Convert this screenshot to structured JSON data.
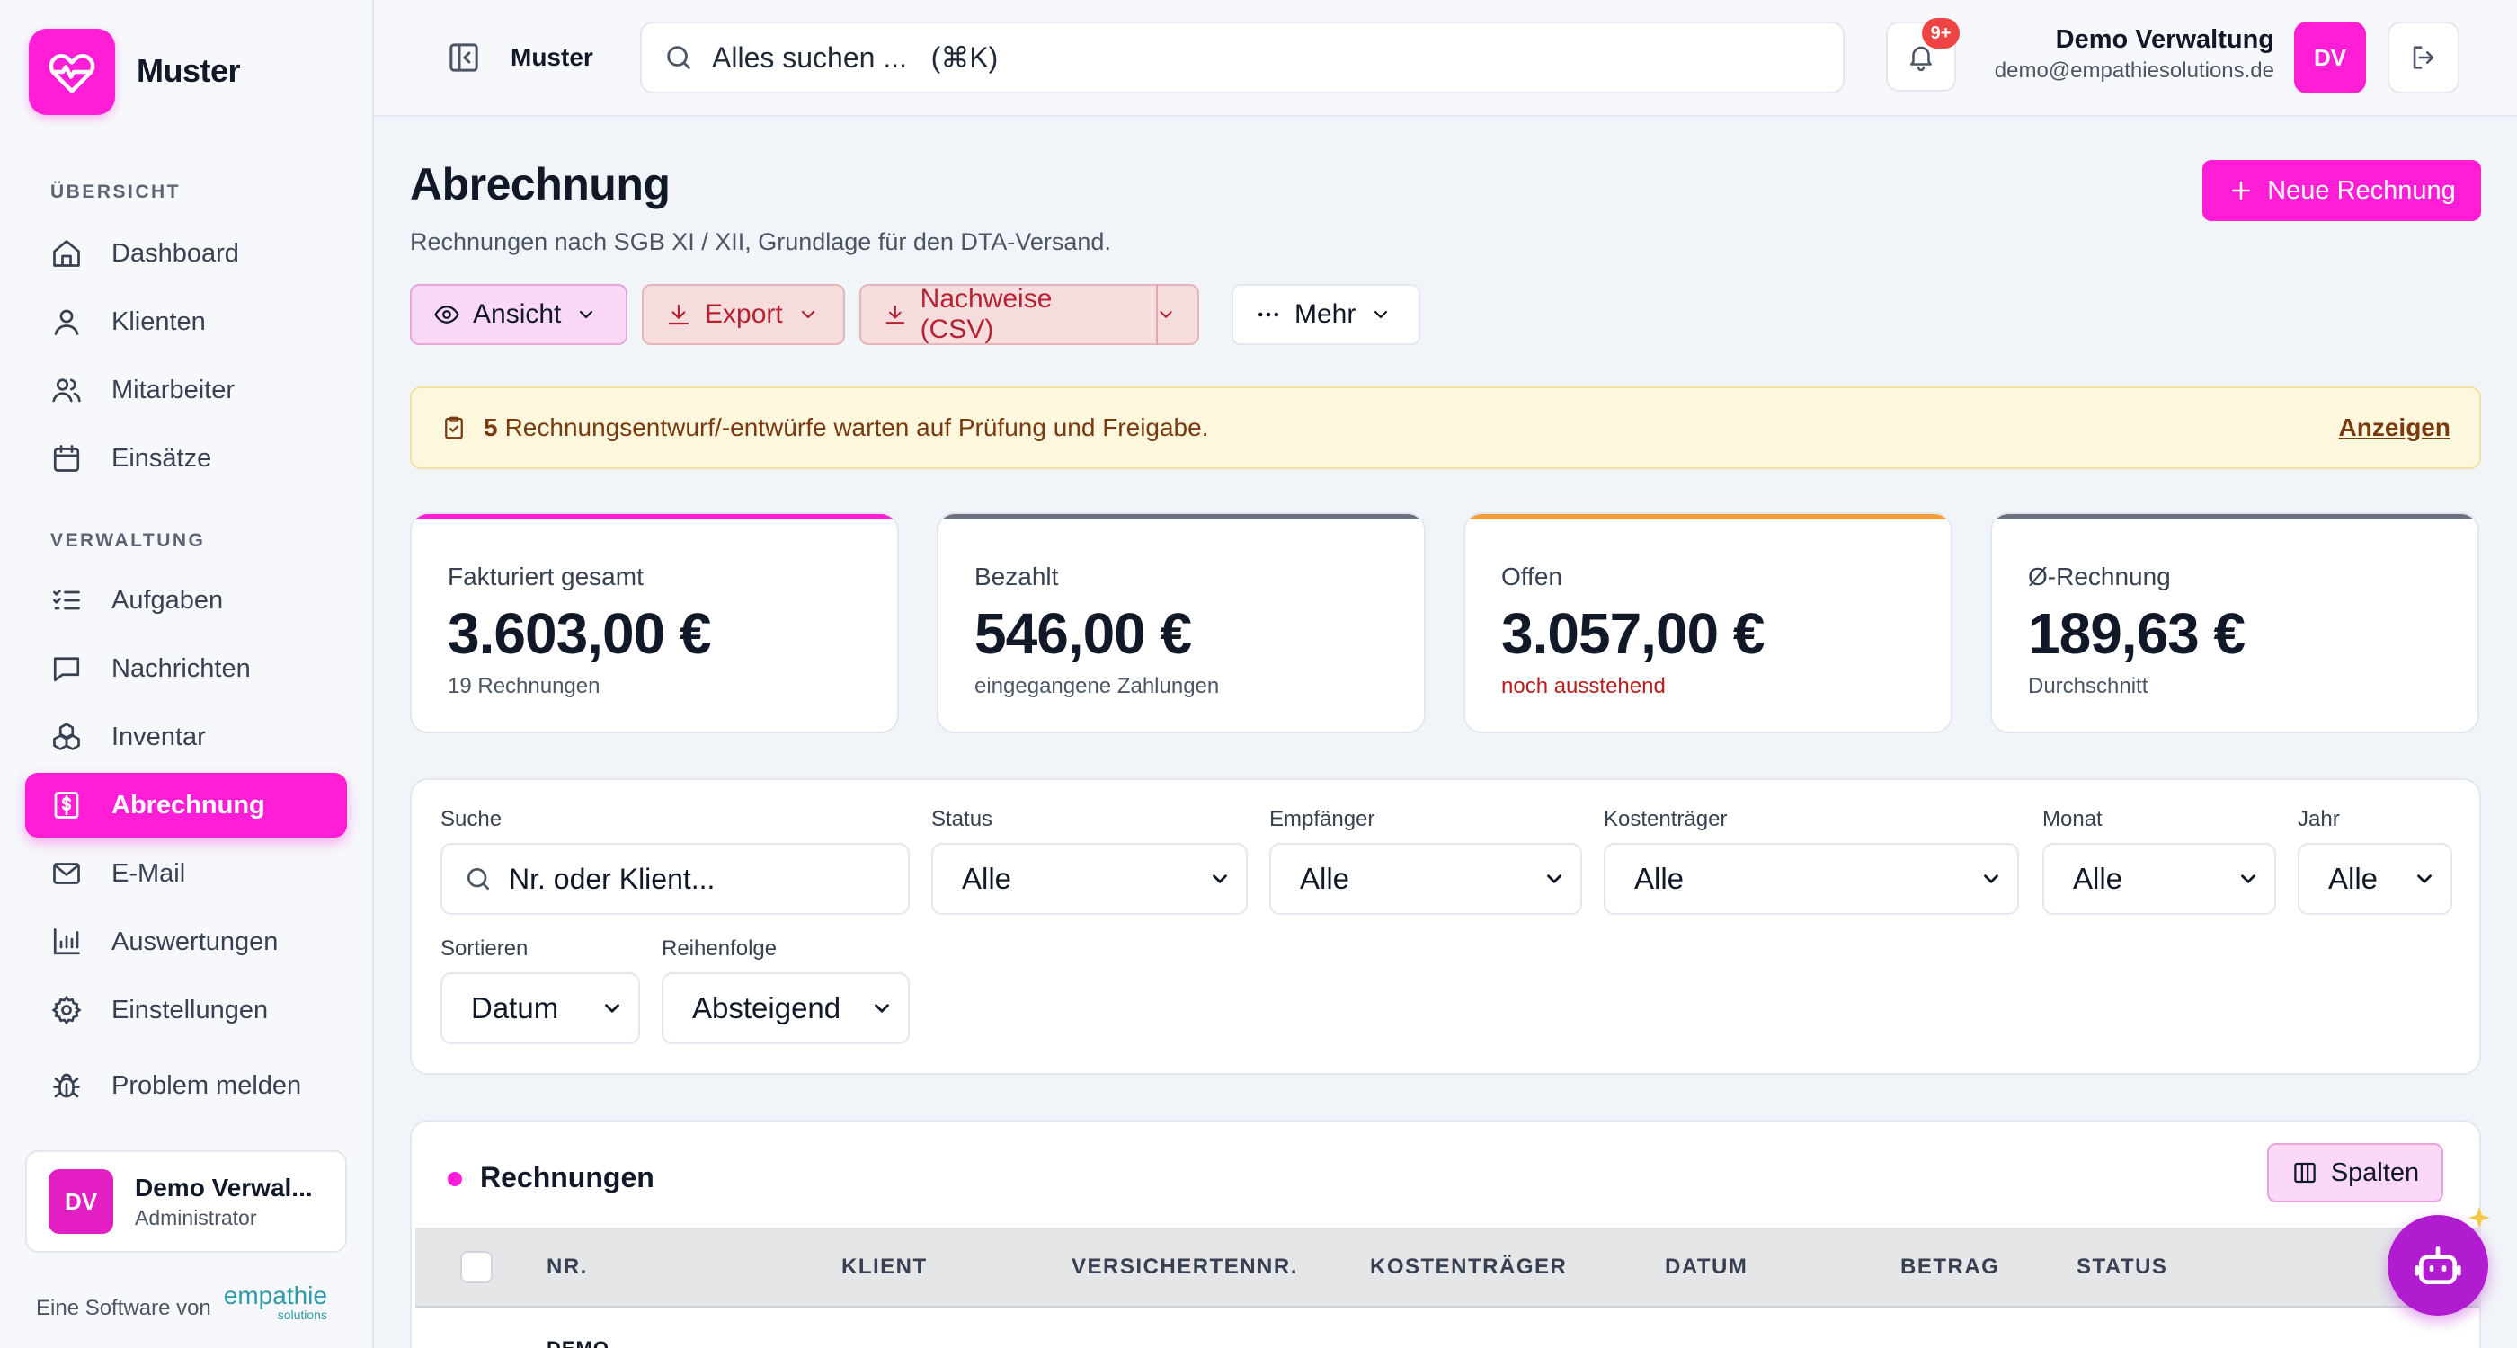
{
  "app": {
    "name": "Muster"
  },
  "sidebar": {
    "section_overview": "ÜBERSICHT",
    "section_admin": "VERWALTUNG",
    "items": [
      {
        "label": "Dashboard",
        "icon": "home-icon"
      },
      {
        "label": "Klienten",
        "icon": "user-icon"
      },
      {
        "label": "Mitarbeiter",
        "icon": "users-icon"
      },
      {
        "label": "Einsätze",
        "icon": "calendar-icon"
      },
      {
        "label": "Aufgaben",
        "icon": "checklist-icon"
      },
      {
        "label": "Nachrichten",
        "icon": "message-icon"
      },
      {
        "label": "Inventar",
        "icon": "boxes-icon"
      },
      {
        "label": "Abrechnung",
        "icon": "invoice-icon",
        "active": true
      },
      {
        "label": "E-Mail",
        "icon": "mail-icon"
      },
      {
        "label": "Auswertungen",
        "icon": "chart-icon"
      },
      {
        "label": "Einstellungen",
        "icon": "gear-icon"
      },
      {
        "label": "Problem melden",
        "icon": "bug-icon"
      }
    ],
    "user": {
      "initials": "DV",
      "name": "Demo Verwal...",
      "role": "Administrator"
    },
    "footer": {
      "prefix": "Eine Software von",
      "brand": "empathie",
      "brand_sub": "solutions"
    }
  },
  "topbar": {
    "workspace": "Muster",
    "search_placeholder": "Alles suchen ...   (⌘K)",
    "notifications_badge": "9+",
    "user_name": "Demo Verwaltung",
    "user_email": "demo@empathiesolutions.de",
    "user_initials": "DV"
  },
  "page": {
    "title": "Abrechnung",
    "subtitle": "Rechnungen nach SGB XI / XII, Grundlage für den DTA-Versand.",
    "new_button": "Neue Rechnung",
    "toolbar": {
      "view": "Ansicht",
      "export": "Export",
      "proofs": "Nachweise (CSV)",
      "more": "Mehr"
    },
    "alert": {
      "count": "5",
      "text": "Rechnungsentwurf/-entwürfe warten auf Prüfung und Freigabe.",
      "link": "Anzeigen"
    }
  },
  "stats": [
    {
      "label": "Fakturiert gesamt",
      "value": "3.603,00 €",
      "sub": "19 Rechnungen",
      "color": "#ff1ed6"
    },
    {
      "label": "Bezahlt",
      "value": "546,00 €",
      "sub": "eingegangene Zahlungen",
      "color": "#6b7280"
    },
    {
      "label": "Offen",
      "value": "3.057,00 €",
      "sub": "noch ausstehend",
      "color": "#f59e3b"
    },
    {
      "label": "Ø-Rechnung",
      "value": "189,63 €",
      "sub": "Durchschnitt",
      "color": "#6b7280"
    }
  ],
  "filters": {
    "search_label": "Suche",
    "search_placeholder": "Nr. oder Klient...",
    "status_label": "Status",
    "status_value": "Alle",
    "recipient_label": "Empfänger",
    "recipient_value": "Alle",
    "payer_label": "Kostenträger",
    "payer_value": "Alle",
    "month_label": "Monat",
    "month_value": "Alle",
    "year_label": "Jahr",
    "year_value": "Alle",
    "sort_label": "Sortieren",
    "sort_value": "Datum",
    "order_label": "Reihenfolge",
    "order_value": "Absteigend"
  },
  "table": {
    "title": "Rechnungen",
    "columns_button": "Spalten",
    "headers": [
      "NR.",
      "KLIENT",
      "VERSICHERTENNR.",
      "KOSTENTRÄGER",
      "DATUM",
      "BETRAG",
      "STATUS"
    ],
    "first_row_peek": "DEMO"
  }
}
